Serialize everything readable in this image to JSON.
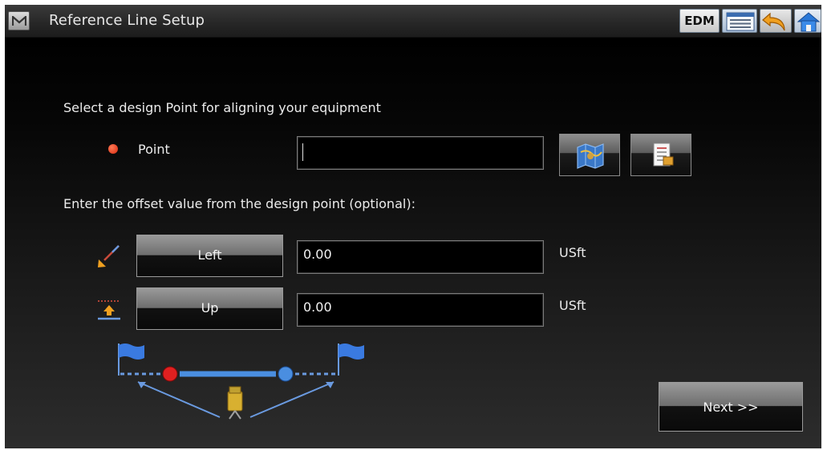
{
  "window": {
    "title": "Reference Line Setup",
    "menu_icon": "m-logo-icon",
    "edm_label": "EDM",
    "list_icon": "list-icon",
    "undo_icon": "undo-arrow-icon",
    "home_icon": "home-icon"
  },
  "point_section": {
    "instruction": "Select a design Point for aligning your equipment",
    "point_label": "Point",
    "point_value": "",
    "map_button_icon": "map-icon",
    "list_button_icon": "point-list-icon",
    "point_status_color": "#e8401c"
  },
  "offset_section": {
    "instruction": "Enter the offset value from the design point (optional):",
    "horizontal": {
      "direction_label": "Left",
      "value": "0.00",
      "unit": "USft",
      "icon": "horizontal-offset-icon"
    },
    "vertical": {
      "direction_label": "Up",
      "value": "0.00",
      "unit": "USft",
      "icon": "vertical-offset-icon"
    }
  },
  "diagram": {
    "icon": "reference-line-diagram",
    "point_colors": [
      "#e02020",
      "#4a8ee0"
    ]
  },
  "actions": {
    "next_label": "Next >>"
  }
}
